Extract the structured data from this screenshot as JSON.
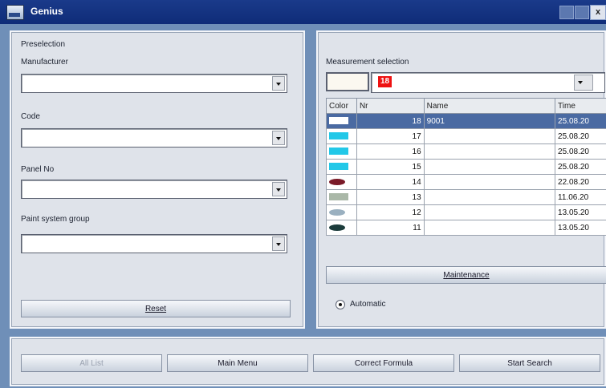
{
  "window": {
    "title": "Genius",
    "close_glyph": "x"
  },
  "preselection": {
    "heading": "Preselection",
    "manufacturer_label": "Manufacturer",
    "code_label": "Code",
    "panel_no_label": "Panel No",
    "paint_system_group_label": "Paint system group",
    "reset_label": "Reset"
  },
  "measurement": {
    "heading": "Measurement selection",
    "selected_value": "18",
    "columns": [
      "Color",
      "Nr",
      "Name",
      "Time"
    ],
    "rows": [
      {
        "color": "#ffffff",
        "shape": "rect",
        "nr": "18",
        "name": "9001",
        "time": "25.08.20",
        "selected": true
      },
      {
        "color": "#22c8e8",
        "shape": "rect",
        "nr": "17",
        "name": "",
        "time": "25.08.20",
        "selected": false
      },
      {
        "color": "#22c8e8",
        "shape": "rect",
        "nr": "16",
        "name": "",
        "time": "25.08.20",
        "selected": false
      },
      {
        "color": "#22c8e8",
        "shape": "rect",
        "nr": "15",
        "name": "",
        "time": "25.08.20",
        "selected": false
      },
      {
        "color": "#7a1a28",
        "shape": "oval",
        "nr": "14",
        "name": "",
        "time": "22.08.20",
        "selected": false
      },
      {
        "color": "#aab8a8",
        "shape": "rect",
        "nr": "13",
        "name": "",
        "time": "11.06.20",
        "selected": false
      },
      {
        "color": "#9ab0c0",
        "shape": "oval",
        "nr": "12",
        "name": "",
        "time": "13.05.20",
        "selected": false
      },
      {
        "color": "#1c3c3c",
        "shape": "oval",
        "nr": "11",
        "name": "",
        "time": "13.05.20",
        "selected": false
      }
    ],
    "maintenance_label": "Maintenance",
    "automatic_label": "Automatic"
  },
  "footer": {
    "buttons": [
      {
        "label": "All List",
        "enabled": false
      },
      {
        "label": "Main Menu",
        "enabled": true
      },
      {
        "label": "Correct Formula",
        "enabled": true
      },
      {
        "label": "Start Search",
        "enabled": true
      }
    ]
  },
  "colors": {
    "titlebar": "#1a3a8a",
    "selection": "#4a6aa2",
    "background": "#6f8fb8",
    "panel": "#dfe3ea"
  }
}
